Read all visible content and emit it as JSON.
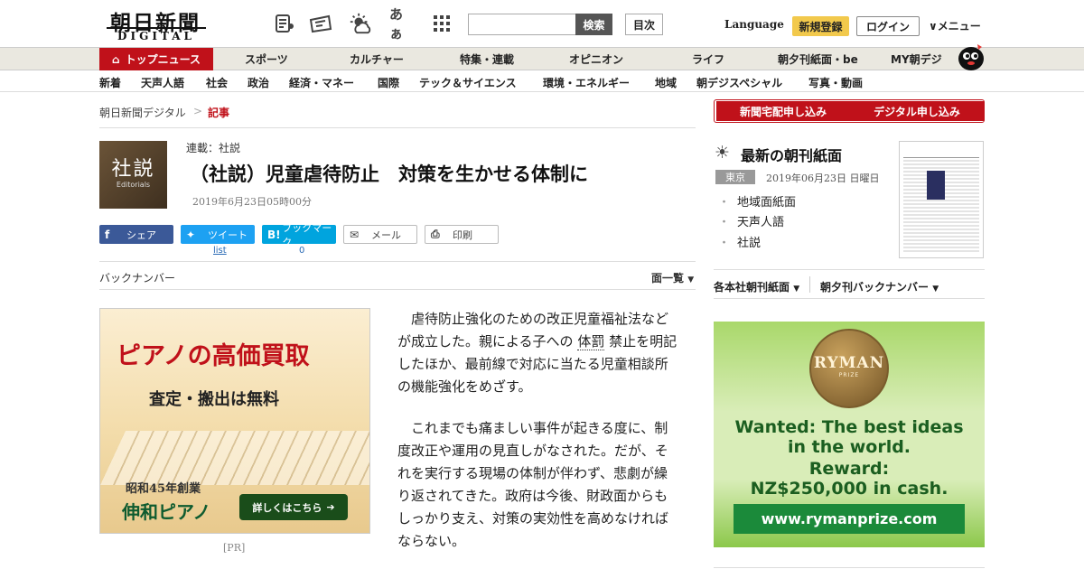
{
  "header": {
    "logo_main": "朝日新聞",
    "logo_sub": "DIGITAL",
    "icons": [
      "article-list-icon",
      "paper-icon",
      "weather-icon",
      "font-size-icon",
      "grid-menu-icon"
    ],
    "font_glyph": "あぁ",
    "search_placeholder": "",
    "search_label": "検索",
    "toc_label": "目次",
    "language": "Language",
    "register": "新規登録",
    "login": "ログイン",
    "menu": "メニュー"
  },
  "mainnav": {
    "items": [
      "トップニュース",
      "スポーツ",
      "カルチャー",
      "特集・連載",
      "オピニオン",
      "ライフ",
      "朝夕刊紙面・be",
      "MY朝デジ"
    ]
  },
  "subnav": {
    "items": [
      "新着",
      "天声人語",
      "社会",
      "政治",
      "経済・マネー",
      "国際",
      "テック＆サイエンス",
      "環境・エネルギー",
      "地域",
      "朝デジスペシャル",
      "写真・動画"
    ]
  },
  "breadcrumb": {
    "home": "朝日新聞デジタル",
    "sep": ">",
    "current": "記事"
  },
  "article": {
    "badge_big": "社説",
    "badge_small": "Editorials",
    "series": "連載：社説",
    "title": "（社説）児童虐待防止　対策を生かせる体制に",
    "date": "2019年6月23日05時00分",
    "p1_a": "虐待防止強化のための改正児童福祉法などが成立した。親による子への",
    "p1_term": "体罰",
    "p1_b": "禁止を明記したほか、最前線で対応に当たる児童相談所の機能強化をめざす。",
    "p2": "これまでも痛ましい事件が起きる度に、制度改正や運用の見直しがなされた。だが、それを実行する現場の体制が伴わず、悲劇が繰り返されてきた。政府は今後、財政面からもしっかり支え、対策の実効性を高めなければならない。"
  },
  "share": {
    "facebook": "シェア",
    "twitter": "ツイート",
    "twitter_count": "list",
    "hatena_icon": "B!",
    "hatena": "ブックマーク",
    "hatena_count": "0",
    "mail": "メール",
    "print": "印刷"
  },
  "backnumber": "バックナンバー",
  "menlist": "面一覧",
  "ad_left": {
    "headline": "ピアノの高価買取",
    "sub": "査定・搬出は無料",
    "since": "昭和45年創業",
    "brand": "伸和ピアノ",
    "cta": "詳しくはこちら",
    "pr": "[PR]"
  },
  "sidebar": {
    "sub_paper": "新聞宅配申し込み",
    "sub_digital": "デジタル申し込み",
    "latest_title": "最新の朝刊紙面",
    "region": "東京",
    "date": "2019年06月23日 日曜日",
    "links": [
      "地域面紙面",
      "天声人語",
      "社説"
    ],
    "select_honsha": "各本社朝刊紙面",
    "select_backnum": "朝夕刊バックナンバー"
  },
  "ad_right": {
    "medal": "RYMAN",
    "medal_sub": "PRIZE",
    "line1": "Wanted: The best ideas",
    "line2": "in the world.",
    "line3": "Reward:",
    "line4": "NZ$250,000 in cash.",
    "url": "www.rymanprize.com"
  }
}
